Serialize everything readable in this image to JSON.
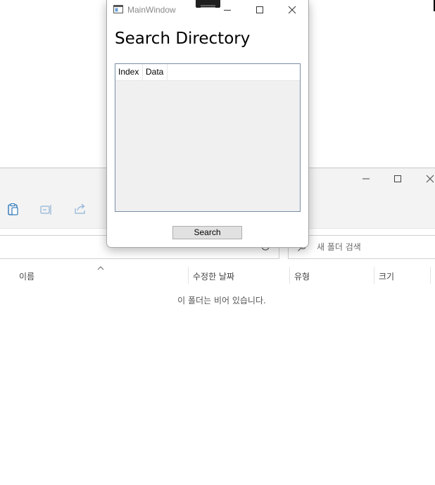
{
  "main_window": {
    "title": "MainWindow",
    "heading": "Search Directory",
    "list_columns": [
      "Index",
      "Data"
    ],
    "search_button_label": "Search"
  },
  "explorer": {
    "search_placeholder": "새 폴더 검색",
    "columns": {
      "name": "이름",
      "date_modified": "수정한 날짜",
      "type": "유형",
      "size": "크기"
    },
    "empty_message": "이 폴더는 비어 있습니다."
  },
  "colors": {
    "listview_border": "#7a8da6",
    "listview_background": "#f0f0f0",
    "explorer_toolbar": "#f3f3f3"
  },
  "icons": {
    "toolbar": [
      "paste-icon",
      "rename-icon",
      "share-icon"
    ],
    "search": "search-icon",
    "sort": "sort-up-icon"
  }
}
